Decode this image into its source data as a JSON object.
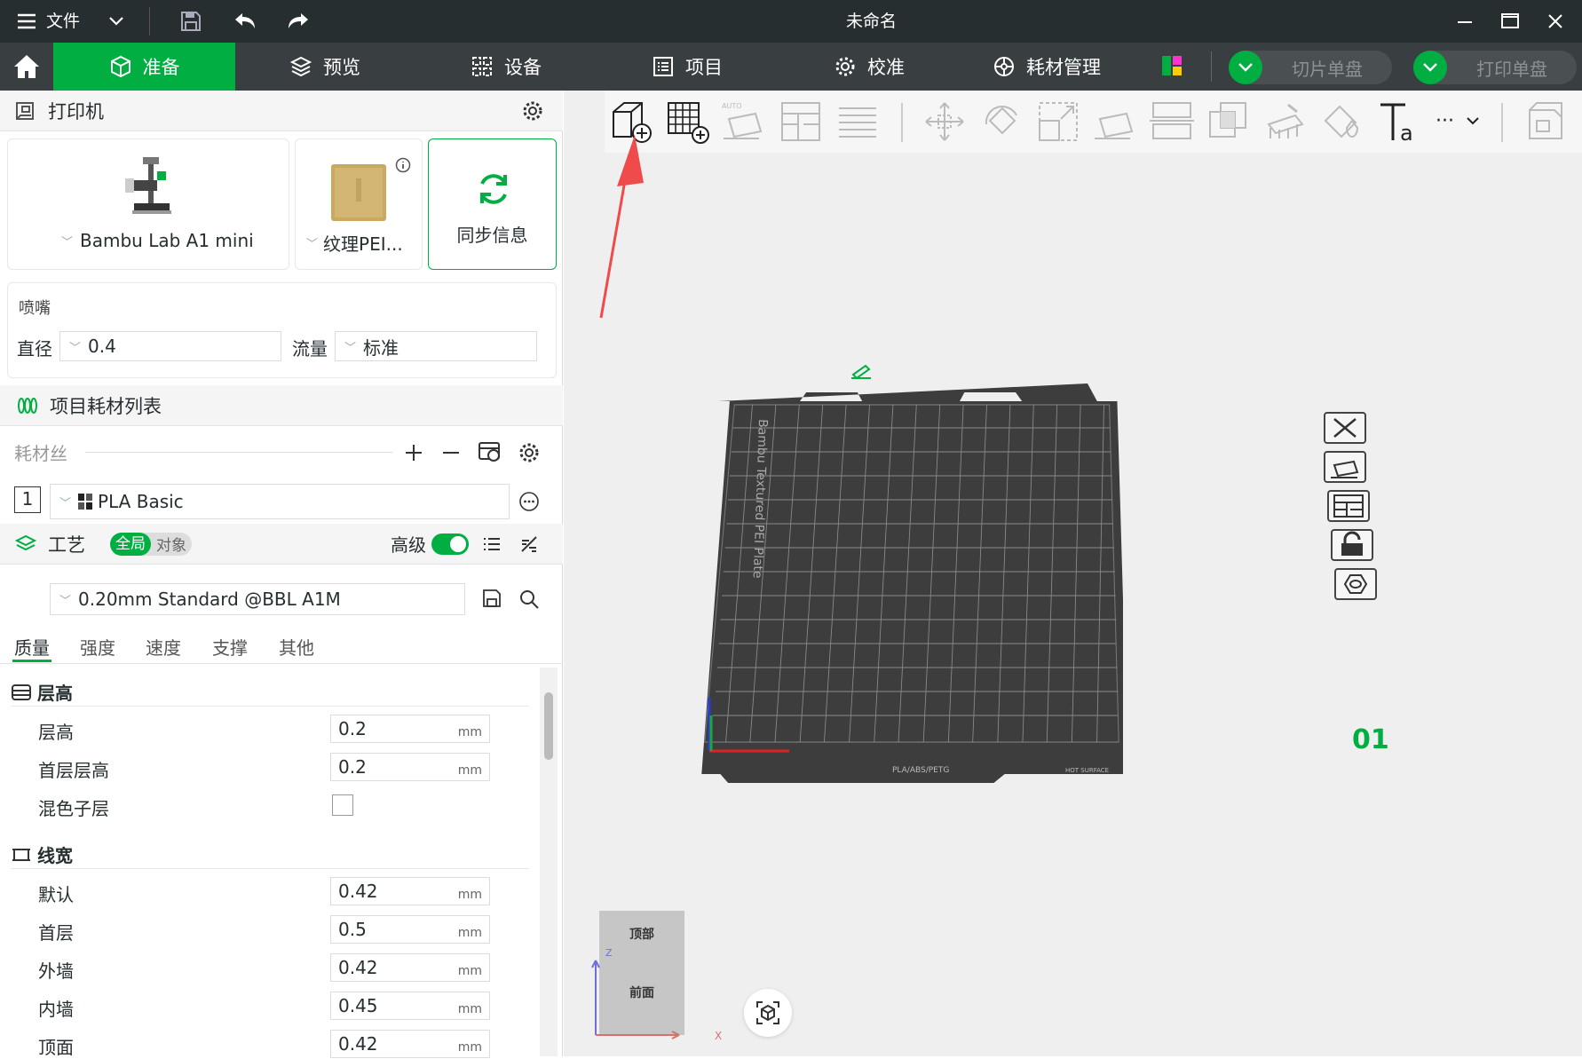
{
  "titlebar": {
    "file_menu": "文件",
    "title": "未命名"
  },
  "tabs": [
    {
      "label": "准备",
      "active": true
    },
    {
      "label": "预览"
    },
    {
      "label": "设备"
    },
    {
      "label": "项目"
    },
    {
      "label": "校准"
    },
    {
      "label": "耗材管理"
    }
  ],
  "actions": {
    "slice_plate": "切片单盘",
    "print_plate": "打印单盘"
  },
  "printer": {
    "section_title": "打印机",
    "model": "Bambu Lab A1 mini",
    "plate": "纹理PEI...",
    "sync": "同步信息"
  },
  "nozzle": {
    "title": "喷嘴",
    "diameter_label": "直径",
    "diameter_value": "0.4",
    "flow_label": "流量",
    "flow_value": "标准"
  },
  "filament": {
    "section_title": "项目耗材列表",
    "list_label": "耗材丝",
    "slot_number": "1",
    "name": "PLA Basic"
  },
  "process": {
    "section_title": "工艺",
    "scope_global": "全局",
    "scope_object": "对象",
    "advanced_label": "高级",
    "advanced_on": true,
    "preset": "0.20mm Standard @BBL A1M",
    "param_tabs": [
      "质量",
      "强度",
      "速度",
      "支撑",
      "其他"
    ],
    "groups": [
      {
        "title": "层高",
        "rows": [
          {
            "label": "层高",
            "value": "0.2",
            "unit": "mm"
          },
          {
            "label": "首层层高",
            "value": "0.2",
            "unit": "mm"
          },
          {
            "label": "混色子层",
            "checkbox": false
          }
        ]
      },
      {
        "title": "线宽",
        "rows": [
          {
            "label": "默认",
            "value": "0.42",
            "unit": "mm"
          },
          {
            "label": "首层",
            "value": "0.5",
            "unit": "mm"
          },
          {
            "label": "外墙",
            "value": "0.42",
            "unit": "mm"
          },
          {
            "label": "内墙",
            "value": "0.45",
            "unit": "mm"
          },
          {
            "label": "顶面",
            "value": "0.42",
            "unit": "mm"
          }
        ]
      }
    ]
  },
  "viewport": {
    "plate_label": "Bambu Textured PEI Plate",
    "plate_number": "01",
    "plate_footer": "PLA/ABS/PETG",
    "plate_footer_right": "HOT SURFACE",
    "cube_top": "顶部",
    "cube_front": "前面",
    "axis_z": "Z",
    "axis_x": "X"
  },
  "colors": {
    "accent": "#00ae42",
    "titlebar": "#262e30",
    "tabbar": "#393e41",
    "plate": "#3d3d3d",
    "annotation_arrow": "#f04b4b"
  }
}
